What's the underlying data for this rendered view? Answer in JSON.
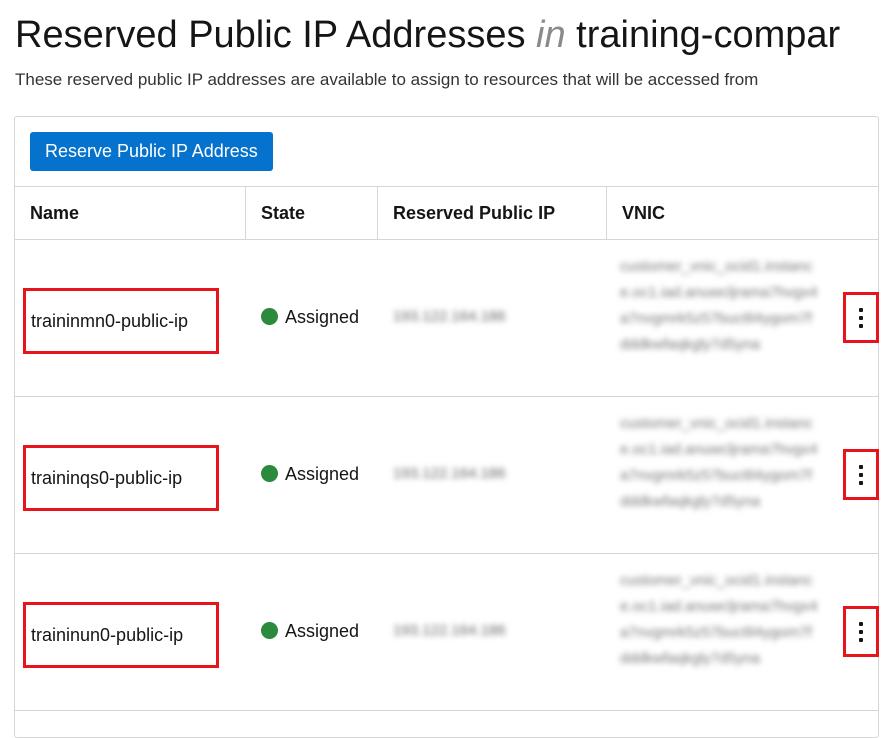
{
  "header": {
    "title_main": "Reserved Public IP Addresses",
    "title_in": "in",
    "title_compartment": "training-compar",
    "description": "These reserved public IP addresses are available to assign to resources that will be accessed from"
  },
  "toolbar": {
    "reserve_label": "Reserve Public IP Address"
  },
  "table": {
    "columns": [
      "Name",
      "State",
      "Reserved Public IP",
      "VNIC"
    ],
    "rows": [
      {
        "name": "traininmn0-public-ip",
        "state": "Assigned",
        "ip": "193.122.164.186",
        "vnic": "customer_vnic_ocid1.instance.oc1.iad.anuwcljrama7hvgx4a7nvgmrk5z57buc6l4ygom7fdddkwfaqkgly7d5yna"
      },
      {
        "name": "traininqs0-public-ip",
        "state": "Assigned",
        "ip": "193.122.164.186",
        "vnic": "customer_vnic_ocid1.instance.oc1.iad.anuwcljrama7hvgx4a7nvgmrk5z57buc6l4ygom7fdddkwfaqkgly7d5yna"
      },
      {
        "name": "traininun0-public-ip",
        "state": "Assigned",
        "ip": "193.122.164.186",
        "vnic": "customer_vnic_ocid1.instance.oc1.iad.anuwcljrama7hvgx4a7nvgmrk5z57buc6l4ygom7fdddkwfaqkgly7d5yna"
      }
    ]
  },
  "colors": {
    "primary_button": "#0572ce",
    "status_assigned": "#2c8a3c",
    "highlight": "#e8141c"
  },
  "icons": {
    "status": "status-dot-icon",
    "actions": "kebab-menu-icon"
  }
}
